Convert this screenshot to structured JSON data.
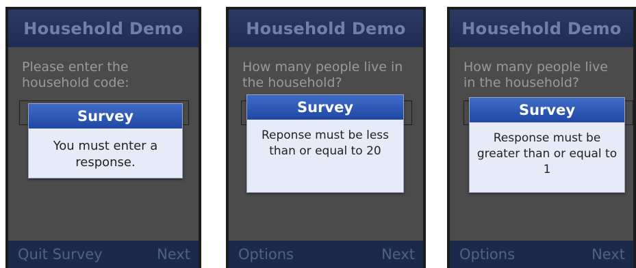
{
  "screens": [
    {
      "title": "Household Demo",
      "prompt": "Please enter the household code:",
      "dialog": {
        "title": "Survey",
        "message": "You must enter a response."
      },
      "softkeys": {
        "left": "Quit Survey",
        "right": "Next"
      }
    },
    {
      "title": "Household Demo",
      "prompt": "How many people live in the household?",
      "dialog": {
        "title": "Survey",
        "message": "Reponse must be less than or equal to 20"
      },
      "softkeys": {
        "left": "Options",
        "right": "Next"
      }
    },
    {
      "title": "Household Demo",
      "prompt": "How many people live in the household?",
      "dialog": {
        "title": "Survey",
        "message": "Response must be greater than or equal to 1"
      },
      "softkeys": {
        "left": "Options",
        "right": "Next"
      }
    }
  ]
}
